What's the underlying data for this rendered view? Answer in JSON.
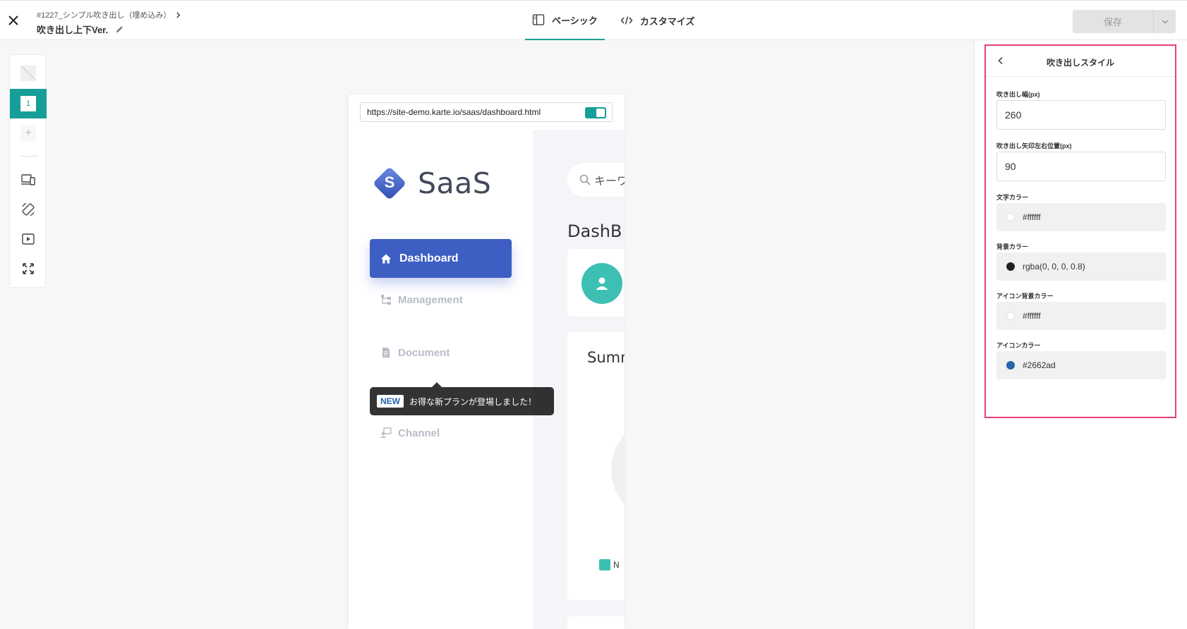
{
  "header": {
    "breadcrumb": "#1227_シンプル吹き出し（埋め込み）",
    "title": "吹き出し上下Ver.",
    "tabs": [
      {
        "label": "ベーシック",
        "active": true
      },
      {
        "label": "カスタマイズ",
        "active": false
      }
    ],
    "save_label": "保存"
  },
  "toolbar": {
    "step_number": "1",
    "add_symbol": "+"
  },
  "preview": {
    "url": "https://site-demo.karte.io/saas/dashboard.html",
    "logo_letter": "S",
    "logo_text": "SaaS",
    "nav": {
      "active": "Dashboard",
      "management": "Management",
      "document": "Document",
      "channel": "Channel"
    },
    "tooltip": {
      "badge": "NEW",
      "text": "お得な新プランが登場しました！"
    },
    "search_placeholder": "キーワ",
    "heading": "DashB",
    "summary_heading": "Summ",
    "legend_label": "N"
  },
  "panel": {
    "title": "吹き出しスタイル",
    "fields": {
      "width_label": "吹き出し幅(px)",
      "width_value": "260",
      "arrow_label": "吹き出し矢印左右位置(px)",
      "arrow_value": "90",
      "text_color_label": "文字カラー",
      "text_color_value": "#ffffff",
      "bg_color_label": "背景カラー",
      "bg_color_value": "rgba(0, 0, 0, 0.8)",
      "icon_bg_label": "アイコン背景カラー",
      "icon_bg_value": "#ffffff",
      "icon_color_label": "アイコンカラー",
      "icon_color_value": "#2662ad"
    }
  },
  "colors": {
    "accent": "#179e98",
    "nav_active": "#3d5fc4",
    "highlight_border": "#e83e78",
    "icon_color": "#2662ad"
  }
}
